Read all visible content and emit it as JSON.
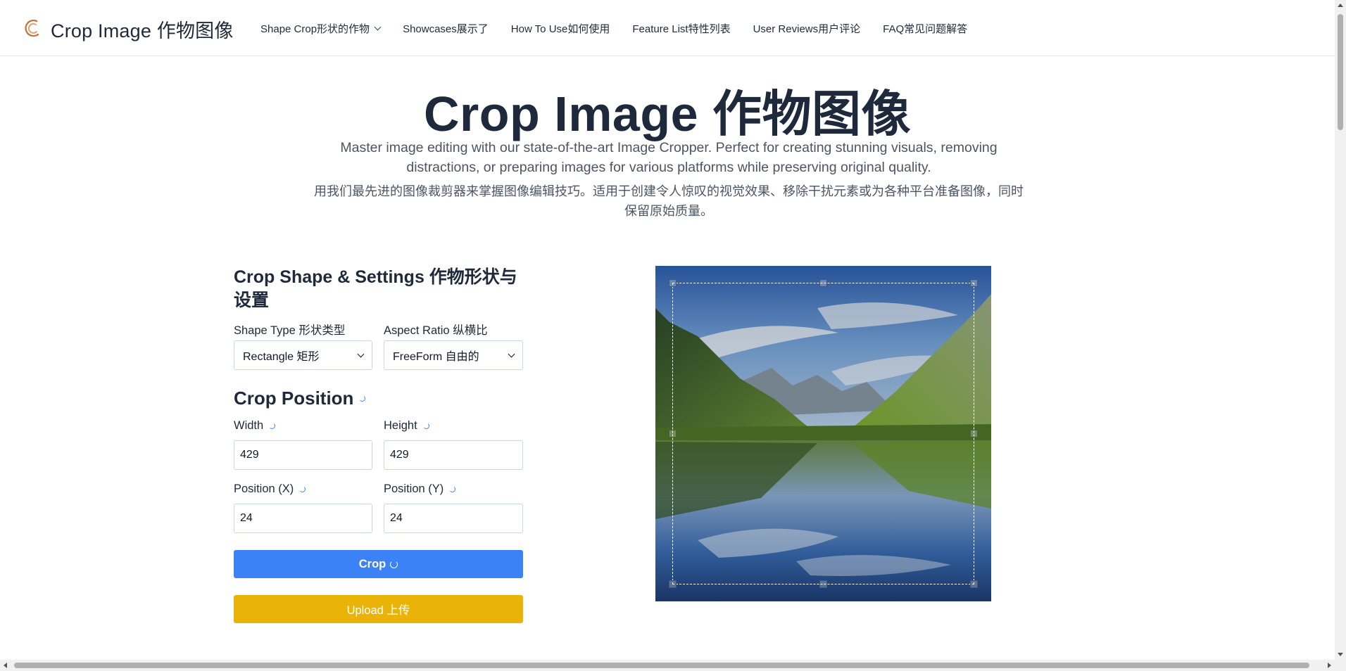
{
  "brand": {
    "name": "Crop Image 作物图像"
  },
  "nav": {
    "items": [
      {
        "label": "Shape Crop形状的作物"
      },
      {
        "label": "Showcases展示了"
      },
      {
        "label": "How To Use如何使用"
      },
      {
        "label": "Feature List特性列表"
      },
      {
        "label": "User Reviews用户评论"
      },
      {
        "label": "FAQ常见问题解答"
      }
    ]
  },
  "hero": {
    "title": "Crop Image 作物图像",
    "subtitle_en": "Master image editing with our state-of-the-art Image Cropper. Perfect for creating stunning visuals, removing distractions, or preparing images for various platforms while preserving original quality.",
    "subtitle_cn": "用我们最先进的图像裁剪器来掌握图像编辑技巧。适用于创建令人惊叹的视觉效果、移除干扰元素或为各种平台准备图像，同时保留原始质量。"
  },
  "settings": {
    "title": "Crop Shape & Settings 作物形状与设置",
    "shape_label": "Shape Type 形状类型",
    "shape_value": "Rectangle 矩形",
    "ratio_label": "Aspect Ratio 纵横比",
    "ratio_value": "FreeForm 自由的"
  },
  "position": {
    "title": "Crop Position",
    "width_label": "Width",
    "width_value": "429",
    "height_label": "Height",
    "height_value": "429",
    "x_label": "Position (X)",
    "x_value": "24",
    "y_label": "Position (Y)",
    "y_value": "24"
  },
  "buttons": {
    "crop": "Crop",
    "upload": "Upload 上传"
  },
  "colors": {
    "crop_button": "#3b82f6",
    "upload_button": "#eab308",
    "logo": "#c2783e"
  }
}
